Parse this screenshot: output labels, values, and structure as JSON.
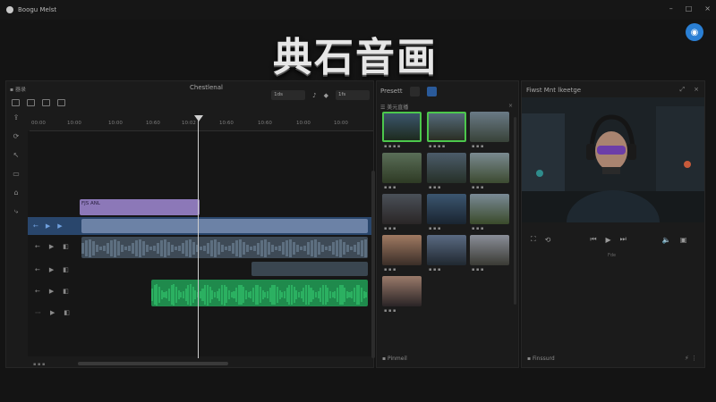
{
  "window": {
    "app_name": "Boogu Melst",
    "controls": [
      "–",
      "□",
      "×"
    ]
  },
  "hero_title": "典石音画",
  "badge_icon": "globe-icon",
  "timeline": {
    "header_label": "▪ 器录",
    "center_title": "Chestlenal",
    "fps_value": "1ds",
    "fps_value2": "1fs",
    "ruler_ticks": [
      "00:00",
      "10:00",
      "10:00",
      "10:60",
      "10:02",
      "10:60",
      "10:60",
      "10:00",
      "10:00"
    ],
    "purple_clip_label": "FJS ANL",
    "blue_clip_label": "",
    "footer": "▪ ▪ ▪"
  },
  "presets": {
    "title": "Presett",
    "subtitle": "☰ 美元直播",
    "close": "×",
    "thumbs": [
      {
        "label": "▪ ▪ ▪ ▪",
        "highlight": true
      },
      {
        "label": "▪ ▪ ▪ ▪",
        "highlight": true
      },
      {
        "label": "▪ ▪ ▪",
        "highlight": false
      },
      {
        "label": "▪ ▪ ▪",
        "highlight": false
      },
      {
        "label": "▪ ▪ ▪",
        "highlight": false
      },
      {
        "label": "▪ ▪ ▪",
        "highlight": false
      },
      {
        "label": "▪ ▪ ▪",
        "highlight": false
      },
      {
        "label": "▪ ▪ ▪",
        "highlight": false
      },
      {
        "label": "▪ ▪ ▪",
        "highlight": false
      },
      {
        "label": "▪ ▪ ▪",
        "highlight": false
      },
      {
        "label": "▪ ▪ ▪",
        "highlight": false
      },
      {
        "label": "▪ ▪ ▪",
        "highlight": false
      },
      {
        "label": "▪ ▪ ▪",
        "highlight": false
      }
    ],
    "footer": "▪ Pinmeil"
  },
  "preview": {
    "title": "Fiwst Mnt lkeetge",
    "mid_label": "Fde",
    "footer": "▪ Finssurd",
    "footer_right": "⚡ ⋮"
  }
}
